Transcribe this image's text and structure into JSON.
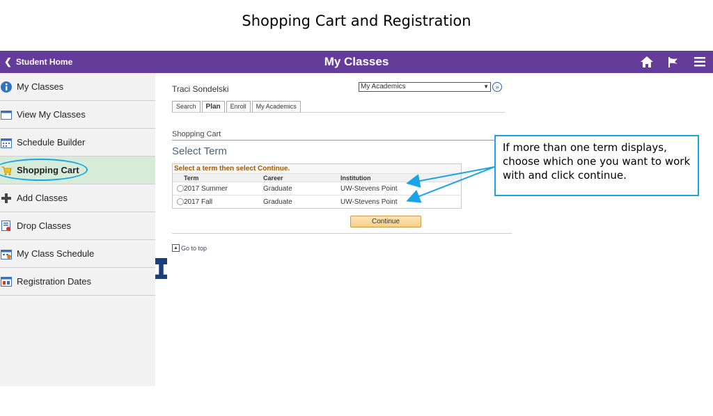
{
  "slide_title": "Shopping Cart and Registration",
  "topbar": {
    "back_label": "Student Home",
    "title": "My Classes",
    "icons": [
      "home-icon",
      "flag-icon",
      "hamburger-menu-icon"
    ]
  },
  "sidebar": {
    "items": [
      {
        "label": "My Classes",
        "icon": "info-icon"
      },
      {
        "label": "View My Classes",
        "icon": "calendar-icon"
      },
      {
        "label": "Schedule Builder",
        "icon": "calendar-grid-icon"
      },
      {
        "label": "Shopping Cart",
        "icon": "shopping-cart-icon",
        "active": true
      },
      {
        "label": "Add Classes",
        "icon": "plus-icon"
      },
      {
        "label": "Drop Classes",
        "icon": "drop-icon"
      },
      {
        "label": "My Class Schedule",
        "icon": "schedule-icon"
      },
      {
        "label": "Registration Dates",
        "icon": "registration-icon"
      }
    ]
  },
  "content": {
    "user_name": "Traci Sondelski",
    "nav_select": "My Academics",
    "tabs": [
      "Search",
      "Plan",
      "Enroll",
      "My Academics"
    ],
    "section": "Shopping Cart",
    "page_title": "Select Term",
    "grid": {
      "title": "Select a term then select Continue.",
      "headers": [
        "Term",
        "Career",
        "Institution"
      ],
      "rows": [
        [
          "2017 Summer",
          "Graduate",
          "UW-Stevens Point"
        ],
        [
          "2017 Fall",
          "Graduate",
          "UW-Stevens Point"
        ]
      ]
    },
    "continue_label": "Continue",
    "go_top_label": "Go to top"
  },
  "callout": "If more than one term displays, choose which one you want to work with and click continue.",
  "colors": {
    "topbar": "#663c9b",
    "active_item": "#d6ecd8",
    "highlight": "#1aa3e8",
    "handle": "#1c3f7a"
  }
}
